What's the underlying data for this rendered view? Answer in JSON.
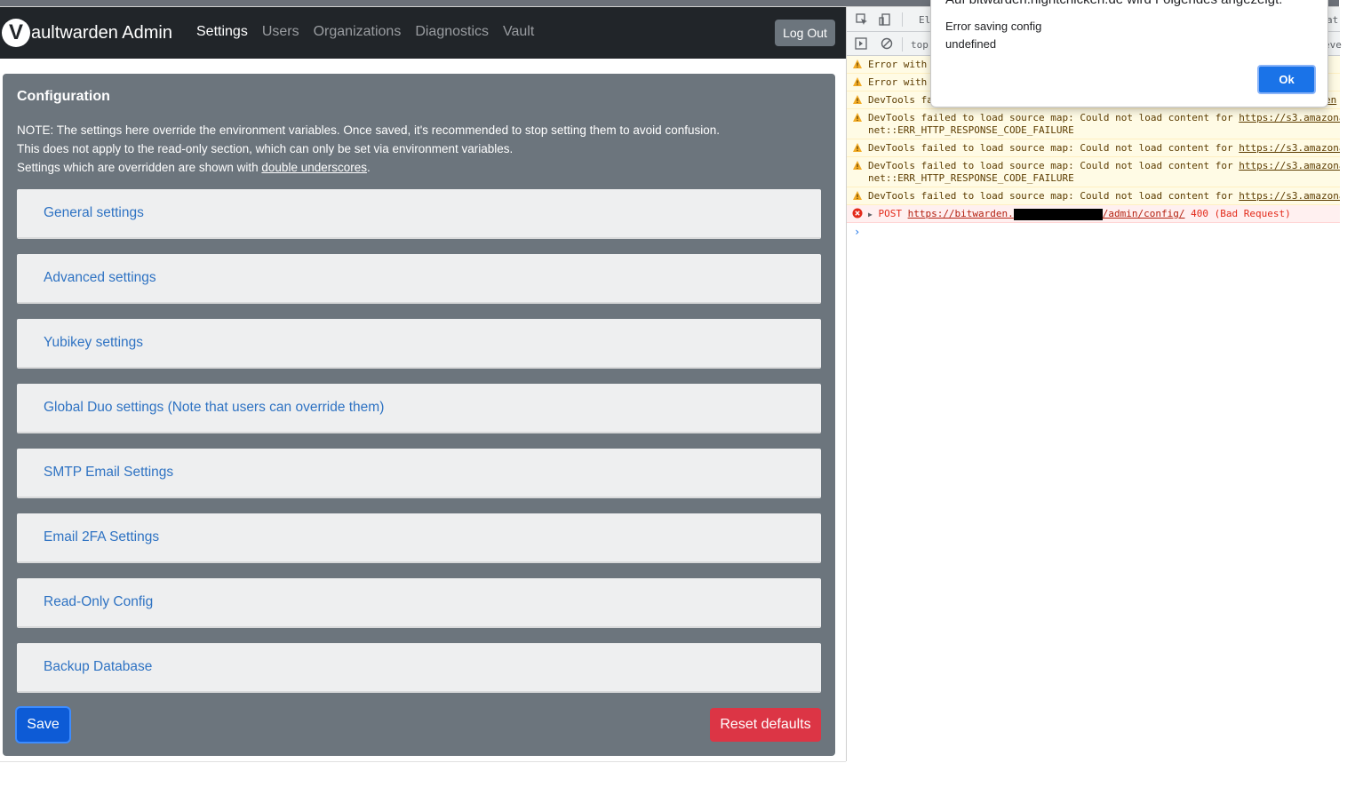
{
  "navbar": {
    "brand": "aultwarden Admin",
    "logo_letter": "V",
    "links": [
      {
        "label": "Settings"
      },
      {
        "label": "Users"
      },
      {
        "label": "Organizations"
      },
      {
        "label": "Diagnostics"
      },
      {
        "label": "Vault"
      }
    ],
    "logout_label": "Log Out"
  },
  "config": {
    "title": "Configuration",
    "note_line1": "NOTE: The settings here override the environment variables. Once saved, it's recommended to stop setting them to avoid confusion.",
    "note_line2": "This does not apply to the read-only section, which can only be set via environment variables.",
    "note_line3_prefix": "Settings which are overridden are shown with ",
    "note_line3_link": "double underscores",
    "note_line3_suffix": ".",
    "sections": [
      {
        "label": "General settings"
      },
      {
        "label": "Advanced settings"
      },
      {
        "label": "Yubikey settings"
      },
      {
        "label": "Global Duo settings (Note that users can override them)"
      },
      {
        "label": "SMTP Email Settings"
      },
      {
        "label": "Email 2FA Settings"
      },
      {
        "label": "Read-Only Config"
      },
      {
        "label": "Backup Database"
      }
    ],
    "save_label": "Save",
    "reset_label": "Reset defaults"
  },
  "devtools": {
    "tab_partial": "Ele",
    "tab_partial_right": "at",
    "context": "top",
    "filter_partial": "eve",
    "logs": [
      {
        "level": "warn",
        "text": "Error with"
      },
      {
        "level": "warn",
        "text": "Error with"
      },
      {
        "level": "warn",
        "text": "DevTools fa",
        "trail": "en"
      },
      {
        "level": "warn",
        "text": "DevTools failed to load source map: Could not load content for ",
        "link": "https://s3.amazona",
        "line2": "net::ERR_HTTP_RESPONSE_CODE_FAILURE"
      },
      {
        "level": "warn",
        "text": "DevTools failed to load source map: Could not load content for ",
        "link": "https://s3.amazona"
      },
      {
        "level": "warn",
        "text": "DevTools failed to load source map: Could not load content for ",
        "link": "https://s3.amazona",
        "line2": "net::ERR_HTTP_RESPONSE_CODE_FAILURE"
      },
      {
        "level": "warn",
        "text": "DevTools failed to load source map: Could not load content for ",
        "link": "https://s3.amazona"
      }
    ],
    "error": {
      "method": "POST",
      "url_prefix": "https://bitwarden.",
      "url_suffix": "/admin/config/",
      "status": "400 (Bad Request)"
    },
    "prompt": "›"
  },
  "dialog": {
    "header": "Auf bitwarden.nightchicken.de wird Folgendes angezeigt:",
    "message_line1": "Error saving config",
    "message_line2": "undefined",
    "ok_label": "Ok"
  },
  "colors": {
    "navbar": "#212529",
    "card": "#6c757d",
    "section_text": "#2f73c3",
    "save": "#0d5bd6",
    "reset": "#dc3545",
    "dialog_ok": "#1a73e8"
  }
}
